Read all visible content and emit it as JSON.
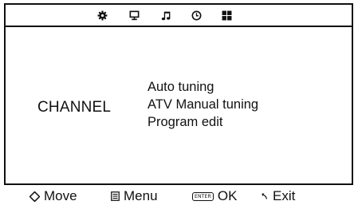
{
  "icon_bar": {
    "icons": [
      "gear-icon",
      "monitor-icon",
      "music-note-icon",
      "clock-icon",
      "grid-icon"
    ]
  },
  "menu": {
    "title": "CHANNEL",
    "items": [
      {
        "label": "Auto tuning"
      },
      {
        "label": "ATV Manual tuning"
      },
      {
        "label": "Program edit"
      }
    ]
  },
  "hints": {
    "move": {
      "icon": "diamond-arrows-icon",
      "label": "Move"
    },
    "menu": {
      "icon": "menu-list-icon",
      "label": "Menu"
    },
    "ok": {
      "key": "ENTER",
      "label": "OK"
    },
    "exit": {
      "icon": "return-arrow-icon",
      "label": "Exit"
    }
  },
  "colors": {
    "foreground": "#111111",
    "background": "#ffffff"
  }
}
